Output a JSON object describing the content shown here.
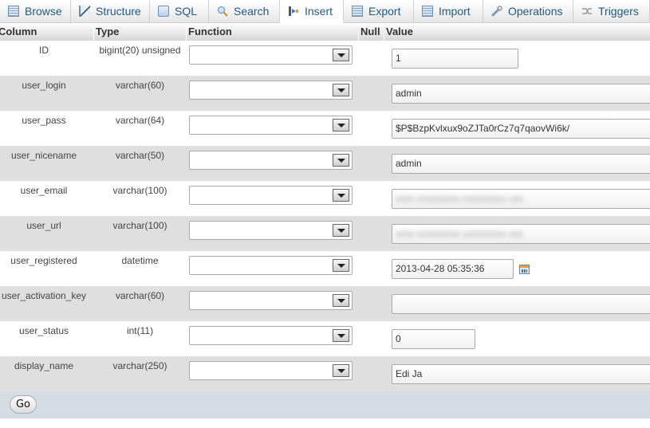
{
  "tabs": [
    {
      "label": "Browse",
      "icon": "browse-icon"
    },
    {
      "label": "Structure",
      "icon": "structure-icon"
    },
    {
      "label": "SQL",
      "icon": "sql-icon"
    },
    {
      "label": "Search",
      "icon": "search-icon"
    },
    {
      "label": "Insert",
      "icon": "insert-icon",
      "active": true
    },
    {
      "label": "Export",
      "icon": "export-icon"
    },
    {
      "label": "Import",
      "icon": "import-icon"
    },
    {
      "label": "Operations",
      "icon": "wrench-icon"
    },
    {
      "label": "Triggers",
      "icon": "triggers-icon"
    }
  ],
  "table": {
    "headers": {
      "column": "Column",
      "type": "Type",
      "function": "Function",
      "null": "Null",
      "value": "Value"
    },
    "rows": [
      {
        "column": "ID",
        "type": "bigint(20) unsigned",
        "function": "",
        "value": "1"
      },
      {
        "column": "user_login",
        "type": "varchar(60)",
        "function": "",
        "value": "admin"
      },
      {
        "column": "user_pass",
        "type": "varchar(64)",
        "function": "",
        "value": "$P$BzpKvlxux9oZJTa0rCz7q7qaovWi6k/"
      },
      {
        "column": "user_nicename",
        "type": "varchar(50)",
        "function": "",
        "value": "admin"
      },
      {
        "column": "user_email",
        "type": "varchar(100)",
        "function": "",
        "value": "(blurred)"
      },
      {
        "column": "user_url",
        "type": "varchar(100)",
        "function": "",
        "value": "(blurred)"
      },
      {
        "column": "user_registered",
        "type": "datetime",
        "function": "",
        "value": "2013-04-28 05:35:36"
      },
      {
        "column": "user_activation_key",
        "type": "varchar(60)",
        "function": "",
        "value": ""
      },
      {
        "column": "user_status",
        "type": "int(11)",
        "function": "",
        "value": "0"
      },
      {
        "column": "display_name",
        "type": "varchar(250)",
        "function": "",
        "value": "Edi Ja"
      }
    ]
  },
  "footer": {
    "go_label": "Go"
  },
  "colors": {
    "tab_text": "#235a81",
    "row_alt": "#dfdfdf",
    "footer_bg": "#d5dce3"
  }
}
